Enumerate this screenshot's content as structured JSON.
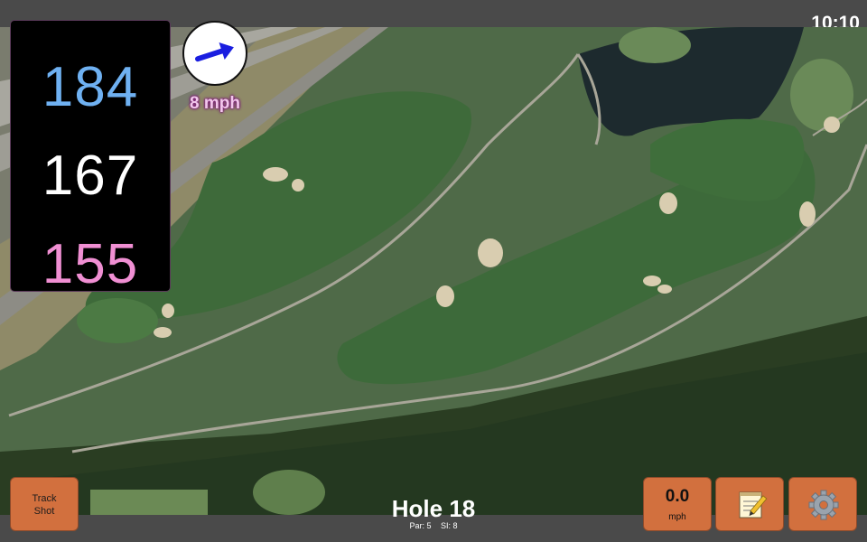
{
  "status_bar": {
    "time": "10:10"
  },
  "distances": {
    "back": "184",
    "middle": "167",
    "front": "155"
  },
  "wind": {
    "speed": "8 mph",
    "icon": "arrow-icon",
    "arrow_color": "#1a1ee0"
  },
  "hole": {
    "title": "Hole 18",
    "par": "Par: 5",
    "si": "SI: 8"
  },
  "buttons": {
    "track_shot": [
      "Track",
      "Shot"
    ],
    "speed_value": "0.0",
    "speed_unit": "mph",
    "notes_icon": "notepad-icon",
    "settings_icon": "gear-icon"
  },
  "colors": {
    "accent_button": "#d2703e",
    "back_distance": "#6fb1f2",
    "middle_distance": "#ffffff",
    "front_distance": "#f08fd3",
    "wind_text": "#f3c7ec"
  }
}
